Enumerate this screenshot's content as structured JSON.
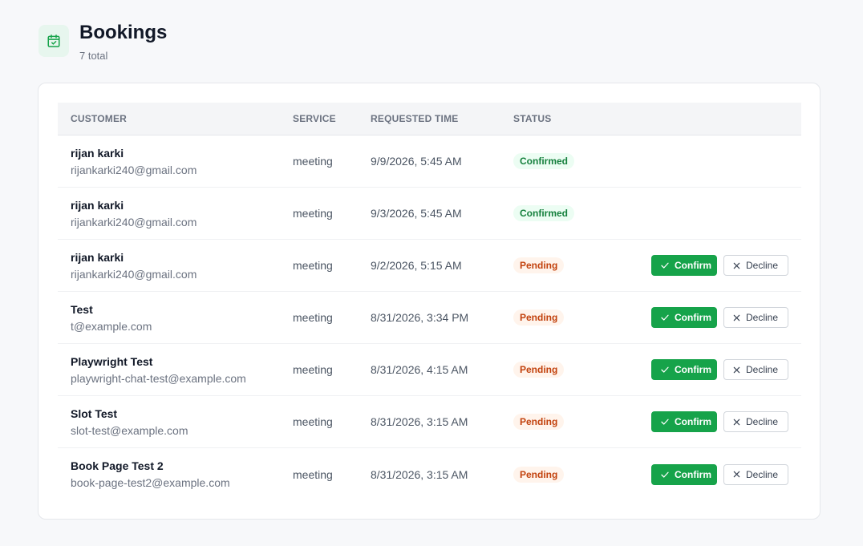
{
  "header": {
    "title": "Bookings",
    "subtitle": "7 total",
    "icon": "calendar-check-icon",
    "accent": "#16a34a"
  },
  "table": {
    "columns": {
      "customer": "CUSTOMER",
      "service": "SERVICE",
      "time": "REQUESTED TIME",
      "status": "STATUS"
    },
    "actions": {
      "confirm_label": "Confirm",
      "decline_label": "Decline"
    },
    "rows": [
      {
        "name": "rijan karki",
        "email": "rijankarki240@gmail.com",
        "service": "meeting",
        "time": "9/9/2026, 5:45 AM",
        "status": "Confirmed"
      },
      {
        "name": "rijan karki",
        "email": "rijankarki240@gmail.com",
        "service": "meeting",
        "time": "9/3/2026, 5:45 AM",
        "status": "Confirmed"
      },
      {
        "name": "rijan karki",
        "email": "rijankarki240@gmail.com",
        "service": "meeting",
        "time": "9/2/2026, 5:15 AM",
        "status": "Pending"
      },
      {
        "name": "Test",
        "email": "t@example.com",
        "service": "meeting",
        "time": "8/31/2026, 3:34 PM",
        "status": "Pending"
      },
      {
        "name": "Playwright Test",
        "email": "playwright-chat-test@example.com",
        "service": "meeting",
        "time": "8/31/2026, 4:15 AM",
        "status": "Pending"
      },
      {
        "name": "Slot Test",
        "email": "slot-test@example.com",
        "service": "meeting",
        "time": "8/31/2026, 3:15 AM",
        "status": "Pending"
      },
      {
        "name": "Book Page Test 2",
        "email": "book-page-test2@example.com",
        "service": "meeting",
        "time": "8/31/2026, 3:15 AM",
        "status": "Pending"
      }
    ]
  }
}
